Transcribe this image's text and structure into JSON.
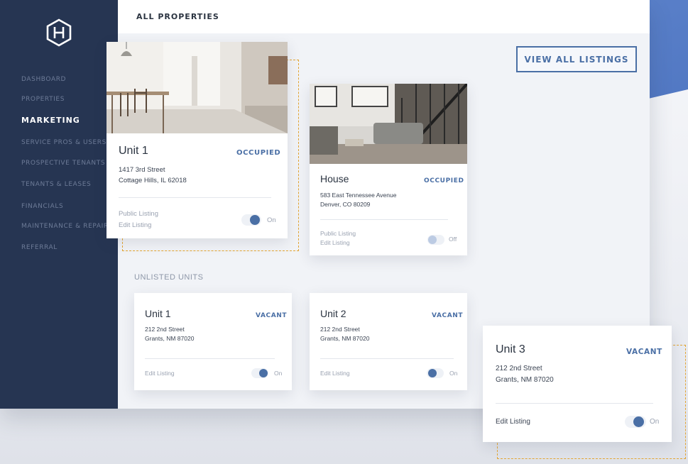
{
  "header": {
    "title": "ALL PROPERTIES"
  },
  "sidebar": {
    "items": [
      {
        "label": "DASHBOARD",
        "active": false
      },
      {
        "label": "PROPERTIES",
        "active": false
      },
      {
        "label": "MARKETING",
        "active": true
      },
      {
        "label": "SERVICE PROS & USERS",
        "active": false
      },
      {
        "label": "PROSPECTIVE TENANTS",
        "active": false
      },
      {
        "label": "TENANTS & LEASES",
        "active": false
      },
      {
        "label": "FINANCIALS",
        "active": false
      },
      {
        "label": "MAINTENANCE & REPAIR",
        "active": false
      },
      {
        "label": "REFERRAL",
        "active": false
      }
    ]
  },
  "view_all_button": {
    "label": "VIEW ALL LISTINGS"
  },
  "sections": {
    "unlisted": "UNLISTED UNITS"
  },
  "listed": [
    {
      "title": "Unit 1",
      "status": "OCCUPIED",
      "address_line1": "1417 3rd Street",
      "address_line2": "Cottage Hills, IL 62018",
      "public_listing": "Public Listing",
      "edit_listing": "Edit Listing",
      "toggle_label": "On",
      "toggle_on": true
    },
    {
      "title": "House",
      "status": "OCCUPIED",
      "address_line1": "583 East Tennessee Avenue",
      "address_line2": "Denver, CO 80209",
      "public_listing": "Public Listing",
      "edit_listing": "Edit Listing",
      "toggle_label": "Off",
      "toggle_on": false
    }
  ],
  "unlisted": [
    {
      "title": "Unit 1",
      "status": "VACANT",
      "address_line1": "212 2nd Street",
      "address_line2": "Grants, NM 87020",
      "edit_listing": "Edit Listing",
      "toggle_label": "On",
      "toggle_on": true
    },
    {
      "title": "Unit 2",
      "status": "VACANT",
      "address_line1": "212 2nd Street",
      "address_line2": "Grants, NM 87020",
      "edit_listing": "Edit Listing",
      "toggle_label": "On",
      "toggle_on": true
    },
    {
      "title": "Unit 3",
      "status": "VACANT",
      "address_line1": "212 2nd Street",
      "address_line2": "Grants, NM 87020",
      "edit_listing": "Edit Listing",
      "toggle_label": "On",
      "toggle_on": true
    }
  ],
  "colors": {
    "sidebar": "#263552",
    "accent": "#4a6fa5",
    "highlight_dash": "#e3a533",
    "background": "#f1f3f7"
  }
}
